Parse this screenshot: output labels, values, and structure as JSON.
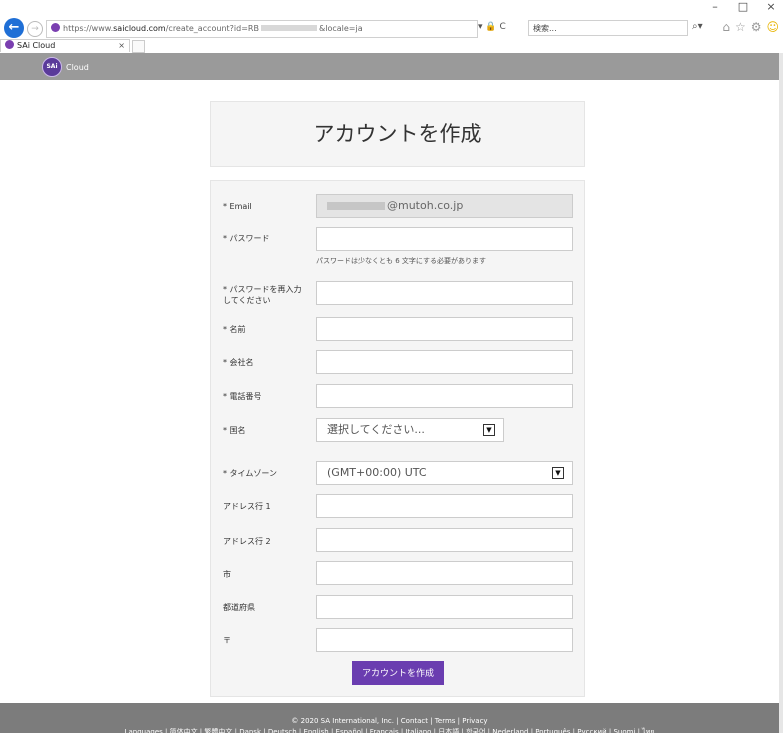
{
  "browser": {
    "window_controls": [
      "–",
      "□",
      "×"
    ],
    "url_scheme_host": "https://www.",
    "url_domain": "saicloud.com",
    "url_path": "/create_account?id=RB",
    "url_tail": "&locale=ja",
    "addr_icons": "▾ 🔒 C",
    "search_placeholder": "検索...",
    "search_glyph": "⌕▾",
    "toolbar_icons": [
      "⌂",
      "☆",
      "⚙",
      "☺"
    ],
    "tab_title": "SAi Cloud",
    "tab_close": "×"
  },
  "header": {
    "logo_badge": "SAi",
    "logo_text": "Cloud"
  },
  "page": {
    "title": "アカウントを作成"
  },
  "form": {
    "email_label": "* Email",
    "email_value": "@mutoh.co.jp",
    "password_label": "* パスワード",
    "password_hint": "パスワードは少なくとも 6 文字にする必要があります",
    "password_confirm_label": "* パスワードを再入力してください",
    "name_label": "* 名前",
    "company_label": "* 会社名",
    "phone_label": "* 電話番号",
    "country_label": "* 国名",
    "country_value": "選択してください...",
    "timezone_label": "* タイムゾーン",
    "timezone_value": "(GMT+00:00) UTC",
    "address1_label": "アドレス行 1",
    "address2_label": "アドレス行 2",
    "city_label": "市",
    "prefecture_label": "都道府県",
    "postal_label": "〒",
    "submit_label": "アカウントを作成"
  },
  "footer": {
    "line1": "© 2020 SA International, Inc. | Contact | Terms | Privacy",
    "line2": "Languages | 简体中文 | 繁體中文 | Dansk | Deutsch | English | Español | Français | Italiano | 日本語 | 한국어 | Nederland | Português | Русский | Suomi | ไทย"
  },
  "colors": {
    "accent": "#6a3db0",
    "header_bg": "#9a9a9a",
    "footer_bg": "#7c7c7c",
    "panel_bg": "#f5f5f5"
  }
}
